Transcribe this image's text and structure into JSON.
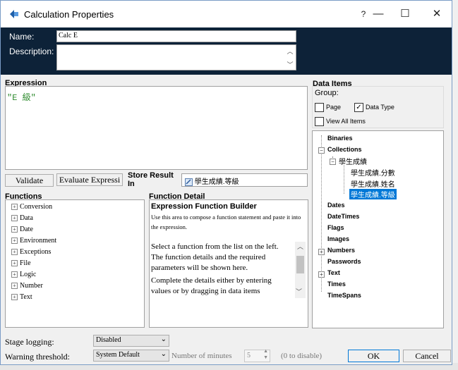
{
  "window": {
    "title": "Calculation Properties",
    "help": "?",
    "minimize": "—",
    "maximize": "☐",
    "close": "✕"
  },
  "header": {
    "name_label": "Name:",
    "name_value": "Calc E",
    "description_label": "Description:",
    "description_value": ""
  },
  "expression": {
    "label": "Expression",
    "text": "\"E 級\""
  },
  "buttons": {
    "validate": "Validate",
    "evaluate": "Evaluate Expressi",
    "ok": "OK",
    "cancel": "Cancel"
  },
  "store_result": {
    "label": "Store Result In",
    "value": "學生成績.等級"
  },
  "functions": {
    "label": "Functions",
    "items": [
      "Conversion",
      "Data",
      "Date",
      "Environment",
      "Exceptions",
      "File",
      "Logic",
      "Number",
      "Text"
    ]
  },
  "function_detail": {
    "label": "Function Detail",
    "title": "Expression Function Builder",
    "intro": "Use this area to compose a function statement and paste it into the expression.",
    "body1": "Select a function from the list on the left. The function details and the required parameters will be shown here.",
    "body2": "Complete the details either by entering values or by dragging in data items"
  },
  "data_items": {
    "label": "Data Items",
    "group_label": "Group:",
    "page": "Page",
    "data_type": "Data Type",
    "view_all": "View All Items",
    "page_checked": false,
    "data_type_checked": true,
    "view_all_checked": false,
    "tree": {
      "binaries": "Binaries",
      "collections": "Collections",
      "collection_name": "學生成績",
      "fields": [
        "學生成績.分數",
        "學生成績.姓名",
        "學生成績.等級"
      ],
      "selected_field": "學生成績.等級",
      "dates": "Dates",
      "datetimes": "DateTimes",
      "flags": "Flags",
      "images": "Images",
      "numbers": "Numbers",
      "passwords": "Passwords",
      "text": "Text",
      "times": "Times",
      "timespans": "TimeSpans"
    }
  },
  "footer": {
    "stage_logging_label": "Stage logging:",
    "stage_logging_value": "Disabled",
    "warning_label": "Warning threshold:",
    "warning_value": "System Default",
    "minutes_label": "Number of minutes",
    "minutes_value": "5",
    "disable_hint": "(0 to disable)"
  },
  "colors": {
    "header_bg": "#0d2238",
    "expression_text": "#2e8b2e",
    "selection": "#0078d7"
  }
}
